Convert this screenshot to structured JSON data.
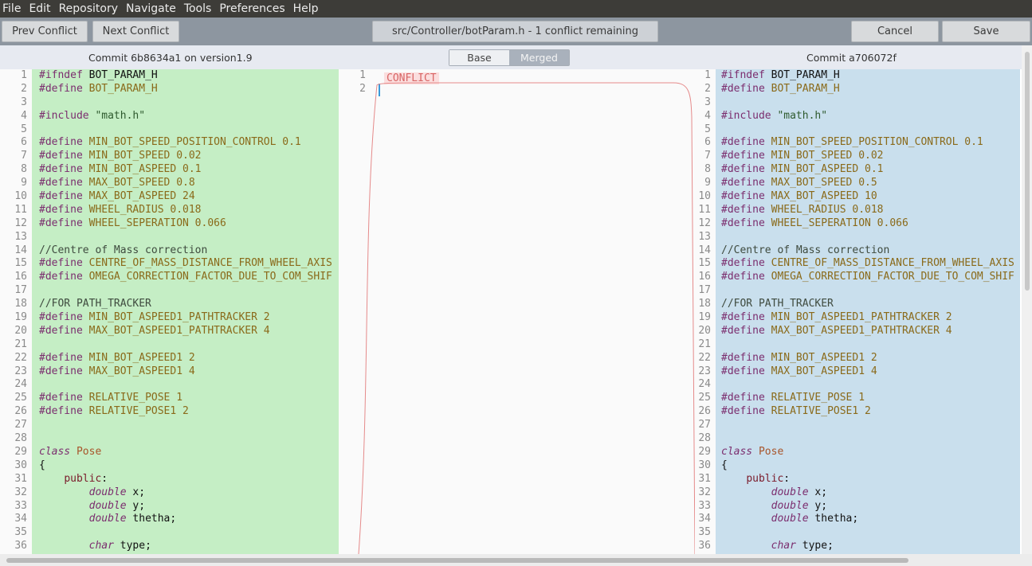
{
  "menu": [
    "File",
    "Edit",
    "Repository",
    "Navigate",
    "Tools",
    "Preferences",
    "Help"
  ],
  "toolbar": {
    "prev_conflict": "Prev Conflict",
    "next_conflict": "Next Conflict",
    "file_status": "src/Controller/botParam.h - 1 conflict remaining",
    "cancel": "Cancel",
    "save": "Save"
  },
  "header": {
    "left_commit": "Commit 6b8634a1 on version1.9",
    "right_commit": "Commit a706072f",
    "base_tab": "Base",
    "merged_tab": "Merged"
  },
  "colors": {
    "left_pane_bg": "#c5eec5",
    "right_pane_bg": "#c9dfed",
    "conflict_line": "#e58a8a"
  },
  "merged": {
    "line_numbers": [
      "1",
      "2"
    ],
    "conflict_label": "CONFLICT"
  },
  "left": {
    "lines": [
      [
        [
          "kw",
          "#ifndef "
        ],
        [
          "id",
          "BOT_PARAM_H"
        ]
      ],
      [
        [
          "kw",
          "#define "
        ],
        [
          "mac",
          "BOT_PARAM_H"
        ]
      ],
      [],
      [
        [
          "kw",
          "#include "
        ],
        [
          "incl",
          "\"math.h\""
        ]
      ],
      [],
      [
        [
          "kw",
          "#define "
        ],
        [
          "mac",
          "MIN_BOT_SPEED_POSITION_CONTROL 0.1"
        ]
      ],
      [
        [
          "kw",
          "#define "
        ],
        [
          "mac",
          "MIN_BOT_SPEED 0.02"
        ]
      ],
      [
        [
          "kw",
          "#define "
        ],
        [
          "mac",
          "MIN_BOT_ASPEED 0.1"
        ]
      ],
      [
        [
          "kw",
          "#define "
        ],
        [
          "mac",
          "MAX_BOT_SPEED 0.8"
        ]
      ],
      [
        [
          "kw",
          "#define "
        ],
        [
          "mac",
          "MAX_BOT_ASPEED 24"
        ]
      ],
      [
        [
          "kw",
          "#define "
        ],
        [
          "mac",
          "WHEEL_RADIUS 0.018"
        ]
      ],
      [
        [
          "kw",
          "#define "
        ],
        [
          "mac",
          "WHEEL_SEPERATION 0.066"
        ]
      ],
      [],
      [
        [
          "cm",
          "//Centre of Mass correction"
        ]
      ],
      [
        [
          "kw",
          "#define "
        ],
        [
          "mac",
          "CENTRE_OF_MASS_DISTANCE_FROM_WHEEL_AXIS"
        ]
      ],
      [
        [
          "kw",
          "#define "
        ],
        [
          "mac",
          "OMEGA_CORRECTION_FACTOR_DUE_TO_COM_SHIF"
        ]
      ],
      [],
      [
        [
          "cm",
          "//FOR PATH_TRACKER"
        ]
      ],
      [
        [
          "kw",
          "#define "
        ],
        [
          "mac",
          "MIN_BOT_ASPEED1_PATHTRACKER 2"
        ]
      ],
      [
        [
          "kw",
          "#define "
        ],
        [
          "mac",
          "MAX_BOT_ASPEED1_PATHTRACKER 4"
        ]
      ],
      [],
      [
        [
          "kw",
          "#define "
        ],
        [
          "mac",
          "MIN_BOT_ASPEED1 2"
        ]
      ],
      [
        [
          "kw",
          "#define "
        ],
        [
          "mac",
          "MAX_BOT_ASPEED1 4"
        ]
      ],
      [],
      [
        [
          "kw",
          "#define "
        ],
        [
          "mac",
          "RELATIVE_POSE 1"
        ]
      ],
      [
        [
          "kw",
          "#define "
        ],
        [
          "mac",
          "RELATIVE_POSE1 2"
        ]
      ],
      [],
      [],
      [
        [
          "it",
          "class "
        ],
        [
          "cls",
          "Pose"
        ]
      ],
      [
        [
          "plain",
          "{"
        ]
      ],
      [
        [
          "plain",
          "    "
        ],
        [
          "pub",
          "public"
        ],
        [
          "plain",
          ":"
        ]
      ],
      [
        [
          "plain",
          "        "
        ],
        [
          "it",
          "double "
        ],
        [
          "plain",
          "x;"
        ]
      ],
      [
        [
          "plain",
          "        "
        ],
        [
          "it",
          "double "
        ],
        [
          "plain",
          "y;"
        ]
      ],
      [
        [
          "plain",
          "        "
        ],
        [
          "it",
          "double "
        ],
        [
          "plain",
          "thetha;"
        ]
      ],
      [],
      [
        [
          "plain",
          "        "
        ],
        [
          "it",
          "char "
        ],
        [
          "plain",
          "type;"
        ]
      ]
    ]
  },
  "right": {
    "lines": [
      [
        [
          "kw",
          "#ifndef "
        ],
        [
          "id",
          "BOT_PARAM_H"
        ]
      ],
      [
        [
          "kw",
          "#define "
        ],
        [
          "mac",
          "BOT_PARAM_H"
        ]
      ],
      [],
      [
        [
          "kw",
          "#include "
        ],
        [
          "incl",
          "\"math.h\""
        ]
      ],
      [],
      [
        [
          "kw",
          "#define "
        ],
        [
          "mac",
          "MIN_BOT_SPEED_POSITION_CONTROL 0.1"
        ]
      ],
      [
        [
          "kw",
          "#define "
        ],
        [
          "mac",
          "MIN_BOT_SPEED 0.02"
        ]
      ],
      [
        [
          "kw",
          "#define "
        ],
        [
          "mac",
          "MIN_BOT_ASPEED 0.1"
        ]
      ],
      [
        [
          "kw",
          "#define "
        ],
        [
          "mac",
          "MAX_BOT_SPEED 0.5"
        ]
      ],
      [
        [
          "kw",
          "#define "
        ],
        [
          "mac",
          "MAX_BOT_ASPEED 10"
        ]
      ],
      [
        [
          "kw",
          "#define "
        ],
        [
          "mac",
          "WHEEL_RADIUS 0.018"
        ]
      ],
      [
        [
          "kw",
          "#define "
        ],
        [
          "mac",
          "WHEEL_SEPERATION 0.066"
        ]
      ],
      [],
      [
        [
          "cm",
          "//Centre of Mass correction"
        ]
      ],
      [
        [
          "kw",
          "#define "
        ],
        [
          "mac",
          "CENTRE_OF_MASS_DISTANCE_FROM_WHEEL_AXIS"
        ]
      ],
      [
        [
          "kw",
          "#define "
        ],
        [
          "mac",
          "OMEGA_CORRECTION_FACTOR_DUE_TO_COM_SHIF"
        ]
      ],
      [],
      [
        [
          "cm",
          "//FOR PATH_TRACKER"
        ]
      ],
      [
        [
          "kw",
          "#define "
        ],
        [
          "mac",
          "MIN_BOT_ASPEED1_PATHTRACKER 2"
        ]
      ],
      [
        [
          "kw",
          "#define "
        ],
        [
          "mac",
          "MAX_BOT_ASPEED1_PATHTRACKER 4"
        ]
      ],
      [],
      [
        [
          "kw",
          "#define "
        ],
        [
          "mac",
          "MIN_BOT_ASPEED1 2"
        ]
      ],
      [
        [
          "kw",
          "#define "
        ],
        [
          "mac",
          "MAX_BOT_ASPEED1 4"
        ]
      ],
      [],
      [
        [
          "kw",
          "#define "
        ],
        [
          "mac",
          "RELATIVE_POSE 1"
        ]
      ],
      [
        [
          "kw",
          "#define "
        ],
        [
          "mac",
          "RELATIVE_POSE1 2"
        ]
      ],
      [],
      [],
      [
        [
          "it",
          "class "
        ],
        [
          "cls",
          "Pose"
        ]
      ],
      [
        [
          "plain",
          "{"
        ]
      ],
      [
        [
          "plain",
          "    "
        ],
        [
          "pub",
          "public"
        ],
        [
          "plain",
          ":"
        ]
      ],
      [
        [
          "plain",
          "        "
        ],
        [
          "it",
          "double "
        ],
        [
          "plain",
          "x;"
        ]
      ],
      [
        [
          "plain",
          "        "
        ],
        [
          "it",
          "double "
        ],
        [
          "plain",
          "y;"
        ]
      ],
      [
        [
          "plain",
          "        "
        ],
        [
          "it",
          "double "
        ],
        [
          "plain",
          "thetha;"
        ]
      ],
      [],
      [
        [
          "plain",
          "        "
        ],
        [
          "it",
          "char "
        ],
        [
          "plain",
          "type;"
        ]
      ]
    ]
  }
}
